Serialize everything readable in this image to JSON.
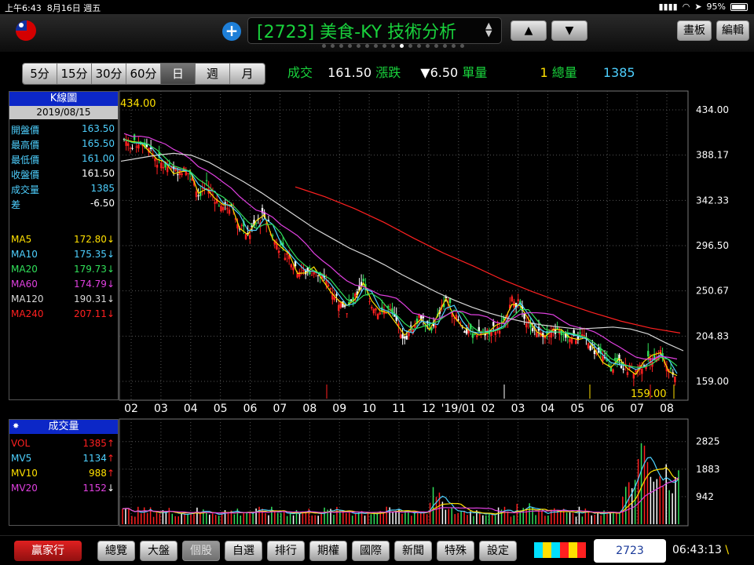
{
  "status": {
    "time": "上午6:43",
    "date": "8月16日 週五",
    "battery": "95%"
  },
  "header": {
    "title": "[2723] 美食-KY 技術分析",
    "updown_arrows": "▲\n▼",
    "board_btn": "畫板",
    "edit_btn": "編輯"
  },
  "periods": [
    "5分",
    "15分",
    "30分",
    "60分",
    "日",
    "週",
    "月"
  ],
  "selected_period": "日",
  "quote": {
    "trade_label": "成交",
    "trade_value": "161.50",
    "change_label": "漲跌",
    "change_value": "▼6.50",
    "unit_label": "單量",
    "unit_value": "1",
    "total_label": "總量",
    "total_value": "1385"
  },
  "kpanel": {
    "title": "K線圖",
    "date": "2019/08/15",
    "rows": [
      {
        "k": "開盤價",
        "v": "163.50",
        "kc": "#4ed0ff",
        "vc": "#4ed0ff"
      },
      {
        "k": "最高價",
        "v": "165.50",
        "kc": "#4ed0ff",
        "vc": "#4ed0ff"
      },
      {
        "k": "最低價",
        "v": "161.00",
        "kc": "#4ed0ff",
        "vc": "#4ed0ff"
      },
      {
        "k": "收盤價",
        "v": "161.50",
        "kc": "#4ed0ff",
        "vc": "#ffffff"
      },
      {
        "k": "成交量",
        "v": "1385",
        "kc": "#4ed0ff",
        "vc": "#4ed0ff"
      },
      {
        "k": "差",
        "v": "-6.50",
        "kc": "#4ed0ff",
        "vc": "#ffffff"
      }
    ],
    "ma": [
      {
        "k": "MA5",
        "v": "172.80↓",
        "c": "#ffe000"
      },
      {
        "k": "MA10",
        "v": "175.35↓",
        "c": "#4ed0ff"
      },
      {
        "k": "MA20",
        "v": "179.73↓",
        "c": "#31e05a"
      },
      {
        "k": "MA60",
        "v": "174.79↓",
        "c": "#e040e0"
      },
      {
        "k": "MA120",
        "v": "190.31↓",
        "c": "#d8d8d8"
      },
      {
        "k": "MA240",
        "v": "207.11↓",
        "c": "#ff2020"
      }
    ]
  },
  "vpanel": {
    "title": "成交量",
    "rows": [
      {
        "k": "VOL",
        "v": "1385",
        "arrow": "↑",
        "c": "#ff2020",
        "ac": "#ff2020"
      },
      {
        "k": "MV5",
        "v": "1134",
        "arrow": "↑",
        "c": "#4ed0ff",
        "ac": "#ff2020"
      },
      {
        "k": "MV10",
        "v": "988",
        "arrow": "↑",
        "c": "#ffe000",
        "ac": "#ff2020"
      },
      {
        "k": "MV20",
        "v": "1152",
        "arrow": "↓",
        "c": "#e040e0",
        "ac": "#ffffff"
      }
    ]
  },
  "bottom": {
    "brand": "贏家行",
    "nav": [
      "總覽",
      "大盤",
      "個股",
      "自選",
      "排行",
      "期權",
      "國際",
      "新聞",
      "特殊",
      "設定"
    ],
    "selected": "個股",
    "stock_code": "2723",
    "clock": "06:43:13"
  },
  "chart_data": [
    {
      "type": "candlestick",
      "price_ticks": [
        "434.00",
        "388.17",
        "342.33",
        "296.50",
        "250.67",
        "204.83",
        "159.00"
      ],
      "ylim": [
        159.0,
        434.0
      ],
      "high_label": "434.00",
      "low_label": "159.00",
      "x_ticks": [
        "02",
        "03",
        "04",
        "05",
        "06",
        "07",
        "08",
        "09",
        "10",
        "11",
        "12",
        "'19/01",
        "02",
        "03",
        "04",
        "05",
        "06",
        "07",
        "08"
      ],
      "close_series": [
        404,
        398,
        402,
        396,
        382,
        378,
        372,
        374,
        369,
        348,
        358,
        345,
        334,
        338,
        318,
        306,
        318,
        330,
        306,
        292,
        286,
        272,
        270,
        271,
        262,
        254,
        240,
        232,
        244,
        262,
        238,
        228,
        232,
        219,
        202,
        214,
        226,
        211,
        222,
        244,
        228,
        212,
        207,
        209,
        210,
        212,
        218,
        241,
        236,
        218,
        210,
        208,
        210,
        208,
        206,
        204,
        200,
        190,
        182,
        174,
        178,
        172,
        170,
        178,
        182,
        190,
        172,
        162
      ],
      "ma120_series": [
        382,
        385,
        388,
        390,
        388,
        381,
        371,
        361,
        350,
        338,
        326,
        314,
        304,
        294,
        286,
        277,
        267,
        258,
        249,
        241,
        234,
        228,
        223,
        219,
        216,
        214,
        212,
        213,
        214,
        212,
        207,
        198,
        190
      ],
      "ma240_series": [
        356,
        346,
        334,
        320,
        304,
        289,
        276,
        262,
        250,
        239,
        229,
        220,
        213,
        208
      ],
      "colors": {
        "up": "#ff2020",
        "down": "#31e05a",
        "ma5": "#ffe000",
        "ma10": "#4ed0ff",
        "ma20": "#31e05a",
        "ma60": "#e040e0",
        "ma120": "#d8d8d8",
        "ma240": "#ff2020"
      }
    },
    {
      "type": "bar",
      "volume_ticks": [
        "2825",
        "1883",
        "942"
      ],
      "ylim": [
        0,
        3300
      ]
    }
  ]
}
